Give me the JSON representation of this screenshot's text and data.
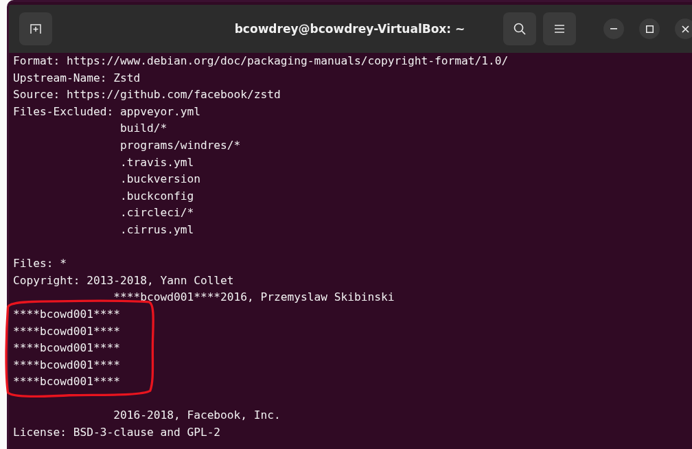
{
  "window": {
    "title": "bcowdrey@bcowdrey-VirtualBox: ~"
  },
  "terminal": {
    "lines": [
      {
        "kind": "text",
        "text": "Format: https://www.debian.org/doc/packaging-manuals/copyright-format/1.0/"
      },
      {
        "kind": "text",
        "text": "Upstream-Name: Zstd"
      },
      {
        "kind": "text",
        "text": "Source: https://github.com/facebook/zstd"
      },
      {
        "kind": "text",
        "text": "Files-Excluded: appveyor.yml"
      },
      {
        "kind": "text",
        "text": "                build/*"
      },
      {
        "kind": "text",
        "text": "                programs/windres/*"
      },
      {
        "kind": "text",
        "text": "                .travis.yml"
      },
      {
        "kind": "text",
        "text": "                .buckversion"
      },
      {
        "kind": "text",
        "text": "                .buckconfig"
      },
      {
        "kind": "text",
        "text": "                .circleci/*"
      },
      {
        "kind": "text",
        "text": "                .cirrus.yml"
      },
      {
        "kind": "blank"
      },
      {
        "kind": "text",
        "text": "Files: *"
      },
      {
        "kind": "text",
        "text": "Copyright: 2013-2018, Yann Collet"
      },
      {
        "kind": "text",
        "text": "               ****bcowd001****2016, Przemyslaw Skibinski"
      },
      {
        "kind": "text",
        "text": "****bcowd001****"
      },
      {
        "kind": "text",
        "text": "****bcowd001****"
      },
      {
        "kind": "text",
        "text": "****bcowd001****"
      },
      {
        "kind": "text",
        "text": "****bcowd001****"
      },
      {
        "kind": "text",
        "text": "****bcowd001****"
      },
      {
        "kind": "blank"
      },
      {
        "kind": "text",
        "text": "               2016-2018, Facebook, Inc."
      },
      {
        "kind": "text",
        "text": "License: BSD-3-clause and GPL-2"
      }
    ]
  }
}
